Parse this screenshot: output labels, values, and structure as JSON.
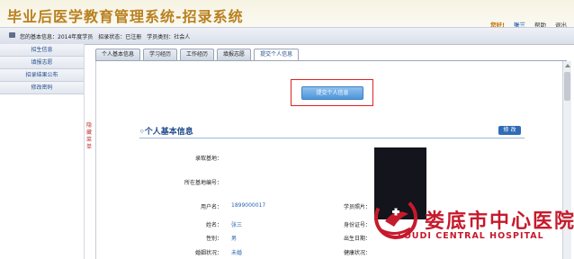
{
  "header": {
    "title": "毕业后医学教育管理系统-招录系统",
    "greeting": "您好!",
    "username": "张三",
    "help": "帮助",
    "logout": "退出"
  },
  "info_bar": {
    "basic_info": "您的基本信息：2014年度学员",
    "status": "招录状态：已注册",
    "category": "学员类别：社会人"
  },
  "sidebar": {
    "items": [
      {
        "label": "招生信息"
      },
      {
        "label": "填报志愿"
      },
      {
        "label": "招录结果公布"
      },
      {
        "label": "修改密码"
      }
    ],
    "collapse_label": "隐藏菜单"
  },
  "tabs": [
    {
      "label": "个人基本信息",
      "active": false
    },
    {
      "label": "学习经历",
      "active": false
    },
    {
      "label": "工作经历",
      "active": false
    },
    {
      "label": "填报志愿",
      "active": false
    },
    {
      "label": "提交个人信息",
      "active": true
    }
  ],
  "panel": {
    "submit_button": "提交个人信息",
    "section_title": "◦个人基本信息",
    "edit_button": "修 改",
    "fields": {
      "enroll_base_label": "录取基地：",
      "current_base_label": "所在基地编号：",
      "username_label": "用户名：",
      "username_value": "1899000017",
      "photo_label": "学员照片：",
      "name_label": "姓名：",
      "name_value": "张三",
      "id_label": "身份证号：",
      "gender_label": "性别：",
      "gender_value": "男",
      "birth_label": "出生日期：",
      "marital_label": "婚姻状况：",
      "marital_value": "未婚",
      "health_label": "健康状况："
    }
  },
  "watermark": {
    "chinese": "娄底市中心医院",
    "english": "LOUDI CENTRAL HOSPITAL"
  },
  "colors": {
    "title": "#b9801f",
    "link": "#2a64b3",
    "highlight_frame": "#dd2222",
    "watermark": "#c61a2c"
  }
}
